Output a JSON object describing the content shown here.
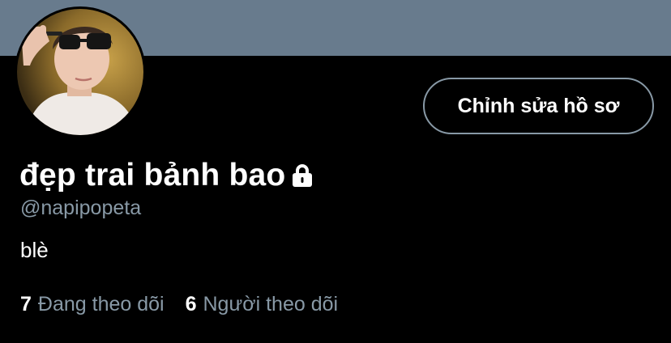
{
  "colors": {
    "banner": "#687b8d",
    "background": "#000000",
    "text_primary": "#ffffff",
    "text_secondary": "#8899a6",
    "button_border": "#8899a6"
  },
  "profile": {
    "display_name": "đẹp trai bảnh bao",
    "handle": "@napipopeta",
    "bio": "blè",
    "protected_icon": "lock-icon",
    "avatar_icon": "avatar-photo"
  },
  "actions": {
    "edit_profile_label": "Chỉnh sửa hồ sơ"
  },
  "stats": {
    "following_count": "7",
    "following_label": "Đang theo dõi",
    "followers_count": "6",
    "followers_label": "Người theo dõi"
  }
}
